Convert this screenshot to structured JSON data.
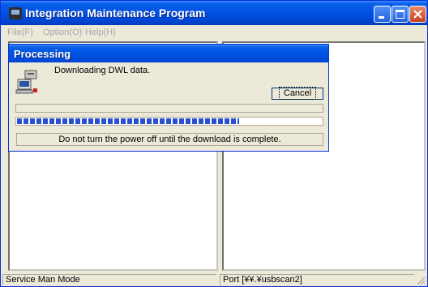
{
  "window": {
    "title": "Integration Maintenance Program",
    "minimize_icon": "minimize-icon",
    "maximize_icon": "maximize-icon",
    "close_icon": "close-icon"
  },
  "menu": {
    "items": [
      "File(F)",
      "Option(O)",
      "Help(H)"
    ]
  },
  "dialog": {
    "title": "Processing",
    "message": "Downloading DWL data.",
    "cancel_label": "Cancel",
    "progress_fraction": 0.73,
    "note": "Do not turn the power off until the download is complete.",
    "icon": "computer-download-icon"
  },
  "status": {
    "mode": "Service Man Mode",
    "port": "Port [¥¥.¥usbscan2]"
  },
  "colors": {
    "titlebar": "#0054e3",
    "progress": "#2a4fd0",
    "window_bg": "#ece9d8"
  }
}
